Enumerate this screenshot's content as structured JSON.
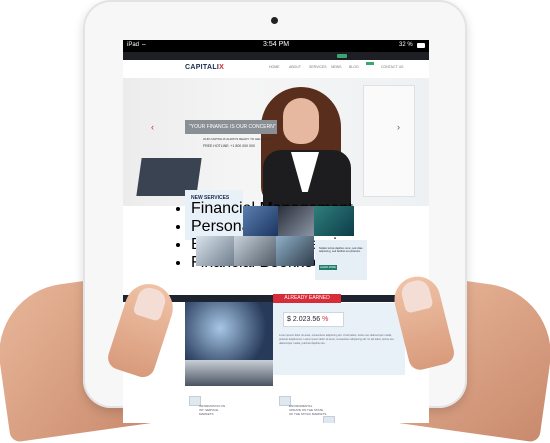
{
  "device": {
    "status_left": "iPad",
    "time": "3:54 PM",
    "battery": "32 %"
  },
  "site": {
    "logo_main": "CAPITALI",
    "logo_accent": "X",
    "nav": [
      "HOME",
      "ABOUT",
      "SERVICES",
      "NEWS",
      "BLOG",
      "CONTACT US"
    ],
    "hero": {
      "quote": "\"YOUR FINANCE IS OUR CONCERN\"",
      "sub": "OUR CAPITALIX ALWAYS READY TO HELP YOU",
      "phone": "FREE HOTLINE: +1 800 000 000"
    },
    "services": {
      "title": "NEW SERVICES",
      "items": [
        "Financial Management",
        "Personal Finance",
        "Business Loan Service",
        "Financial Bookkeeping"
      ]
    },
    "promo": {
      "text": "Nullam luctus dapibus nunc, sed vitae adipiscing, sed facilisis est pharetra.",
      "button": "LEARN MORE"
    },
    "earned": {
      "tag": "ALREADY EARNED",
      "symbol": "$",
      "amount": "2.023.56",
      "suffix": "%",
      "paragraph": "Lorem ipsum dolor sit amet, consectetur adipiscing elit. Ut elit tellus, luctus nec ullamcorper mattis, pulvinar dapibus leo. Lorem ipsum dolor sit amet, consectetur adipiscing elit. Ut elit tellus, luctus nec ullamcorper mattis, pulvinar dapibus leo."
    },
    "features": [
      {
        "line1": "INFORMATION ON",
        "line2": "INT. SERVICE",
        "line3": "MARKETS"
      },
      {
        "line1": "ENVIROMENTAL",
        "line2": "UPDATE ON THE STATE",
        "line3": "OF THE STOCK MARKETS"
      }
    ]
  }
}
